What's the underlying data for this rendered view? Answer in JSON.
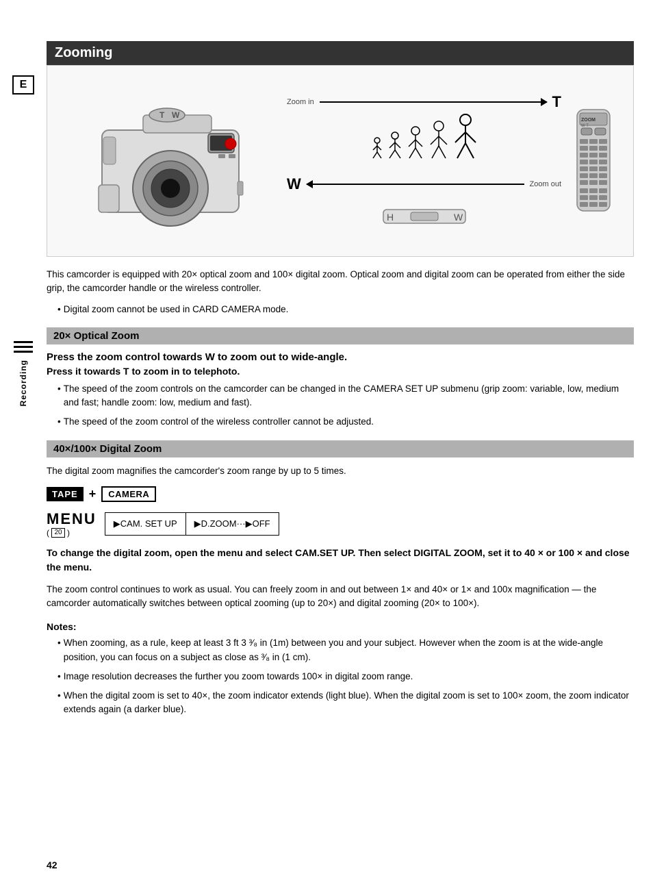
{
  "page": {
    "number": "42",
    "title": "Zooming"
  },
  "sidebar": {
    "e_label": "E",
    "recording_label": "Recording"
  },
  "diagram": {
    "zoom_in_label": "Zoom in",
    "zoom_out_label": "Zoom out",
    "T_label": "T",
    "W_label": "W"
  },
  "intro_text": "This camcorder is equipped with 20× optical zoom and 100× digital zoom. Optical zoom and digital zoom can be operated from either the side grip, the camcorder handle or the wireless controller.",
  "intro_bullet": "Digital zoom cannot be used in CARD CAMERA mode.",
  "optical_zoom": {
    "header": "20× Optical Zoom",
    "title1": "Press the zoom control towards W to zoom out to wide-angle.",
    "title2": "Press it towards T to zoom in to telephoto.",
    "bullet1": "The speed of the zoom controls on the camcorder can be changed in the CAMERA SET UP submenu (grip zoom: variable, low, medium and fast; handle zoom: low, medium and fast).",
    "bullet2": "The speed of the zoom control of the wireless controller cannot be adjusted."
  },
  "digital_zoom": {
    "header": "40×/100× Digital Zoom",
    "intro": "The digital zoom magnifies the camcorder's zoom range by up to 5 times.",
    "tape_badge": "TAPE",
    "camera_badge": "CAMERA",
    "plus": "+",
    "menu_word": "MENU",
    "menu_ref": "( ",
    "menu_page": "20",
    "menu_ref_end": ")",
    "menu_cell1": "▶CAM. SET UP",
    "menu_cell2": "▶D.ZOOM···▶OFF",
    "instruction": "To change the digital zoom, open the menu and select CAM.SET UP. Then select DIGITAL ZOOM, set it to 40 × or 100 × and close the menu.",
    "body1": "The zoom control continues to work as usual. You can freely zoom in and out between 1× and 40× or 1× and 100x magnification — the camcorder automatically switches between optical zooming (up to 20×) and digital zooming (20× to 100×).",
    "notes_header": "Notes:",
    "note1": "When zooming, as a rule, keep at least 3 ft 3 ³⁄₈ in (1m) between you and your subject. However when the zoom is at the wide-angle position, you can focus on a subject as close as ³⁄₈ in (1 cm).",
    "note2": "Image resolution decreases the further you zoom towards 100× in digital zoom range.",
    "note3": "When the digital zoom is set to 40×, the zoom indicator extends (light blue). When the digital zoom is set to 100× zoom, the zoom indicator extends again (a darker blue)."
  }
}
